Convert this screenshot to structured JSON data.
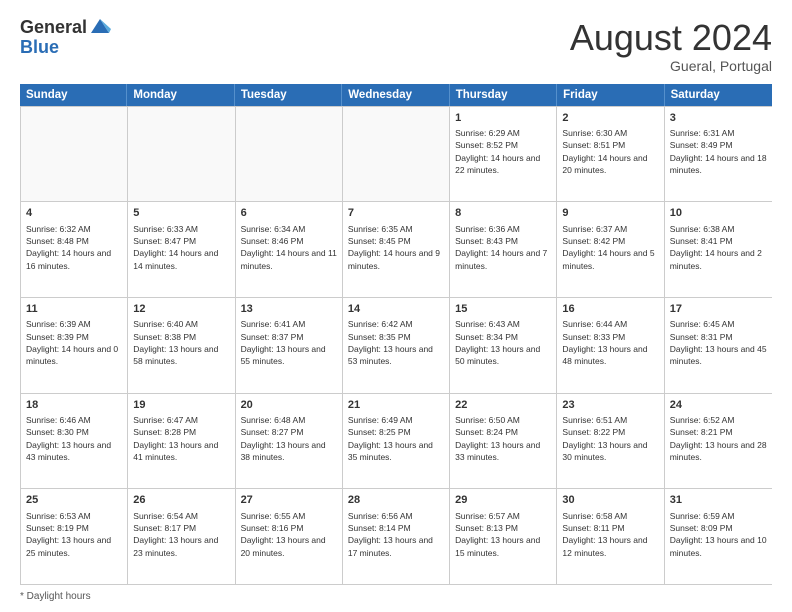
{
  "logo": {
    "general": "General",
    "blue": "Blue"
  },
  "header": {
    "month": "August 2024",
    "location": "Gueral, Portugal"
  },
  "days_of_week": [
    "Sunday",
    "Monday",
    "Tuesday",
    "Wednesday",
    "Thursday",
    "Friday",
    "Saturday"
  ],
  "footer": {
    "daylight_label": "Daylight hours"
  },
  "weeks": [
    [
      {
        "day": "",
        "empty": true
      },
      {
        "day": "",
        "empty": true
      },
      {
        "day": "",
        "empty": true
      },
      {
        "day": "",
        "empty": true
      },
      {
        "day": "1",
        "sunrise": "Sunrise: 6:29 AM",
        "sunset": "Sunset: 8:52 PM",
        "daylight": "Daylight: 14 hours and 22 minutes."
      },
      {
        "day": "2",
        "sunrise": "Sunrise: 6:30 AM",
        "sunset": "Sunset: 8:51 PM",
        "daylight": "Daylight: 14 hours and 20 minutes."
      },
      {
        "day": "3",
        "sunrise": "Sunrise: 6:31 AM",
        "sunset": "Sunset: 8:49 PM",
        "daylight": "Daylight: 14 hours and 18 minutes."
      }
    ],
    [
      {
        "day": "4",
        "sunrise": "Sunrise: 6:32 AM",
        "sunset": "Sunset: 8:48 PM",
        "daylight": "Daylight: 14 hours and 16 minutes."
      },
      {
        "day": "5",
        "sunrise": "Sunrise: 6:33 AM",
        "sunset": "Sunset: 8:47 PM",
        "daylight": "Daylight: 14 hours and 14 minutes."
      },
      {
        "day": "6",
        "sunrise": "Sunrise: 6:34 AM",
        "sunset": "Sunset: 8:46 PM",
        "daylight": "Daylight: 14 hours and 11 minutes."
      },
      {
        "day": "7",
        "sunrise": "Sunrise: 6:35 AM",
        "sunset": "Sunset: 8:45 PM",
        "daylight": "Daylight: 14 hours and 9 minutes."
      },
      {
        "day": "8",
        "sunrise": "Sunrise: 6:36 AM",
        "sunset": "Sunset: 8:43 PM",
        "daylight": "Daylight: 14 hours and 7 minutes."
      },
      {
        "day": "9",
        "sunrise": "Sunrise: 6:37 AM",
        "sunset": "Sunset: 8:42 PM",
        "daylight": "Daylight: 14 hours and 5 minutes."
      },
      {
        "day": "10",
        "sunrise": "Sunrise: 6:38 AM",
        "sunset": "Sunset: 8:41 PM",
        "daylight": "Daylight: 14 hours and 2 minutes."
      }
    ],
    [
      {
        "day": "11",
        "sunrise": "Sunrise: 6:39 AM",
        "sunset": "Sunset: 8:39 PM",
        "daylight": "Daylight: 14 hours and 0 minutes."
      },
      {
        "day": "12",
        "sunrise": "Sunrise: 6:40 AM",
        "sunset": "Sunset: 8:38 PM",
        "daylight": "Daylight: 13 hours and 58 minutes."
      },
      {
        "day": "13",
        "sunrise": "Sunrise: 6:41 AM",
        "sunset": "Sunset: 8:37 PM",
        "daylight": "Daylight: 13 hours and 55 minutes."
      },
      {
        "day": "14",
        "sunrise": "Sunrise: 6:42 AM",
        "sunset": "Sunset: 8:35 PM",
        "daylight": "Daylight: 13 hours and 53 minutes."
      },
      {
        "day": "15",
        "sunrise": "Sunrise: 6:43 AM",
        "sunset": "Sunset: 8:34 PM",
        "daylight": "Daylight: 13 hours and 50 minutes."
      },
      {
        "day": "16",
        "sunrise": "Sunrise: 6:44 AM",
        "sunset": "Sunset: 8:33 PM",
        "daylight": "Daylight: 13 hours and 48 minutes."
      },
      {
        "day": "17",
        "sunrise": "Sunrise: 6:45 AM",
        "sunset": "Sunset: 8:31 PM",
        "daylight": "Daylight: 13 hours and 45 minutes."
      }
    ],
    [
      {
        "day": "18",
        "sunrise": "Sunrise: 6:46 AM",
        "sunset": "Sunset: 8:30 PM",
        "daylight": "Daylight: 13 hours and 43 minutes."
      },
      {
        "day": "19",
        "sunrise": "Sunrise: 6:47 AM",
        "sunset": "Sunset: 8:28 PM",
        "daylight": "Daylight: 13 hours and 41 minutes."
      },
      {
        "day": "20",
        "sunrise": "Sunrise: 6:48 AM",
        "sunset": "Sunset: 8:27 PM",
        "daylight": "Daylight: 13 hours and 38 minutes."
      },
      {
        "day": "21",
        "sunrise": "Sunrise: 6:49 AM",
        "sunset": "Sunset: 8:25 PM",
        "daylight": "Daylight: 13 hours and 35 minutes."
      },
      {
        "day": "22",
        "sunrise": "Sunrise: 6:50 AM",
        "sunset": "Sunset: 8:24 PM",
        "daylight": "Daylight: 13 hours and 33 minutes."
      },
      {
        "day": "23",
        "sunrise": "Sunrise: 6:51 AM",
        "sunset": "Sunset: 8:22 PM",
        "daylight": "Daylight: 13 hours and 30 minutes."
      },
      {
        "day": "24",
        "sunrise": "Sunrise: 6:52 AM",
        "sunset": "Sunset: 8:21 PM",
        "daylight": "Daylight: 13 hours and 28 minutes."
      }
    ],
    [
      {
        "day": "25",
        "sunrise": "Sunrise: 6:53 AM",
        "sunset": "Sunset: 8:19 PM",
        "daylight": "Daylight: 13 hours and 25 minutes."
      },
      {
        "day": "26",
        "sunrise": "Sunrise: 6:54 AM",
        "sunset": "Sunset: 8:17 PM",
        "daylight": "Daylight: 13 hours and 23 minutes."
      },
      {
        "day": "27",
        "sunrise": "Sunrise: 6:55 AM",
        "sunset": "Sunset: 8:16 PM",
        "daylight": "Daylight: 13 hours and 20 minutes."
      },
      {
        "day": "28",
        "sunrise": "Sunrise: 6:56 AM",
        "sunset": "Sunset: 8:14 PM",
        "daylight": "Daylight: 13 hours and 17 minutes."
      },
      {
        "day": "29",
        "sunrise": "Sunrise: 6:57 AM",
        "sunset": "Sunset: 8:13 PM",
        "daylight": "Daylight: 13 hours and 15 minutes."
      },
      {
        "day": "30",
        "sunrise": "Sunrise: 6:58 AM",
        "sunset": "Sunset: 8:11 PM",
        "daylight": "Daylight: 13 hours and 12 minutes."
      },
      {
        "day": "31",
        "sunrise": "Sunrise: 6:59 AM",
        "sunset": "Sunset: 8:09 PM",
        "daylight": "Daylight: 13 hours and 10 minutes."
      }
    ]
  ]
}
